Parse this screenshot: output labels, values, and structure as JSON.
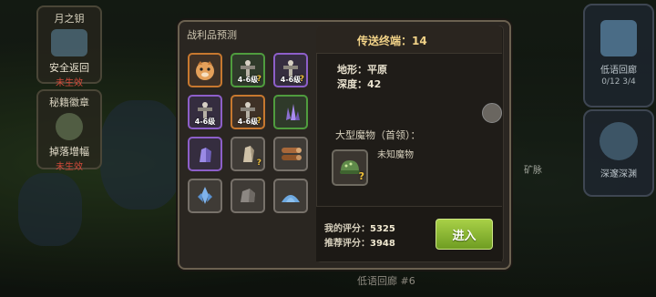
{
  "left_panel": {
    "card1": {
      "title": "月之钥",
      "label": "安全返回",
      "status": "未生效"
    },
    "card2": {
      "title": "秘籍徽章",
      "label": "掉落增幅",
      "status": "未生效"
    }
  },
  "right_panel": {
    "card1": {
      "label": "低语回廊",
      "count_a": "0/12",
      "count_b": "3/4"
    },
    "card2": {
      "label": "深邃深渊"
    },
    "ore_label": "矿脉"
  },
  "bottom_hint": "低语回廊 #6",
  "loot": {
    "title": "战利品预测",
    "level_range": "4-6级",
    "slots": [
      {
        "name": "pet-shiba",
        "rarity": "orange",
        "icon": "shiba-icon"
      },
      {
        "name": "totem-lv",
        "rarity": "green",
        "icon": "totem-icon",
        "lvl": true,
        "unknown": true
      },
      {
        "name": "totem-lv",
        "rarity": "purple",
        "icon": "totem-icon",
        "lvl": true,
        "unknown": true
      },
      {
        "name": "totem-lv",
        "rarity": "purple",
        "icon": "totem-icon",
        "lvl": true
      },
      {
        "name": "totem-lv",
        "rarity": "orange",
        "icon": "totem-icon",
        "lvl": true,
        "unknown": true
      },
      {
        "name": "crystal-purple",
        "rarity": "green",
        "icon": "crystal-icon"
      },
      {
        "name": "crystal-violet",
        "rarity": "purple",
        "icon": "crystal-icon"
      },
      {
        "name": "crystal-unknown",
        "rarity": "gray",
        "icon": "crystal-icon",
        "unknown": true
      },
      {
        "name": "wood-log",
        "rarity": "gray",
        "icon": "wood-icon"
      },
      {
        "name": "crystal-blue",
        "rarity": "gray",
        "icon": "ice-crystal-icon"
      },
      {
        "name": "stone",
        "rarity": "gray",
        "icon": "stone-icon"
      },
      {
        "name": "sand-pile",
        "rarity": "gray",
        "icon": "sand-icon"
      }
    ]
  },
  "info": {
    "destination_label": "传送终端：",
    "destination_value": "14",
    "terrain_label": "地形：",
    "terrain_value": "平原",
    "depth_label": "深度：",
    "depth_value": "42",
    "boss_label": "大型魔物（首领）：",
    "boss_value": "未知魔物",
    "my_score_label": "我的评分：",
    "my_score_value": "5325",
    "rec_score_label": "推荐评分：",
    "rec_score_value": "3948",
    "enter_label": "进入"
  },
  "colors": {
    "enter": "#8bb832",
    "title": "#f1d287",
    "orange": "#c7782f",
    "purple": "#8d5fc9",
    "green": "#4f9c3e"
  }
}
